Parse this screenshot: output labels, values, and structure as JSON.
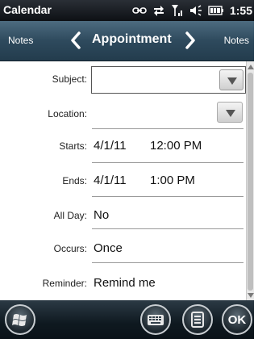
{
  "statusbar": {
    "app_title": "Calendar",
    "time": "1:55",
    "icons": [
      "link-icon",
      "sync-icon",
      "signal-icon",
      "volume-icon",
      "battery-icon"
    ]
  },
  "navbar": {
    "left_label": "Notes",
    "title": "Appointment",
    "right_label": "Notes"
  },
  "form": {
    "subject": {
      "label": "Subject:",
      "value": ""
    },
    "location": {
      "label": "Location:",
      "value": ""
    },
    "starts": {
      "label": "Starts:",
      "date": "4/1/11",
      "time": "12:00 PM"
    },
    "ends": {
      "label": "Ends:",
      "date": "4/1/11",
      "time": "1:00 PM"
    },
    "all_day": {
      "label": "All Day:",
      "value": "No"
    },
    "occurs": {
      "label": "Occurs:",
      "value": "Once"
    },
    "reminder": {
      "label": "Reminder:",
      "value": "Remind me"
    }
  },
  "bottombar": {
    "ok_label": "OK",
    "buttons": [
      "windows-start-icon",
      "keyboard-icon",
      "menu-icon",
      "ok-icon"
    ]
  },
  "colors": {
    "navbar": "#2e4a5d",
    "statusbar": "#0d1014",
    "bottombar": "#0f1920"
  }
}
